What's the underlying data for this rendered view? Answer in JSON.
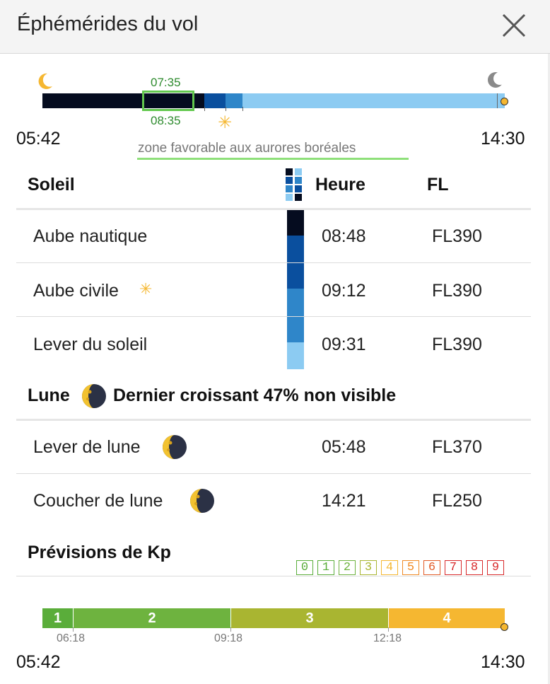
{
  "header": {
    "title": "Éphémérides du vol",
    "close_icon": "close-icon"
  },
  "timeline": {
    "start_time": "05:42",
    "end_time": "14:30",
    "aurora_start": "07:35",
    "aurora_end": "08:35",
    "aurora_label": "zone favorable aux aurores boréales",
    "colors": {
      "night": "#050c1f",
      "nautical": "#0a4f9e",
      "civil": "#2f86c9",
      "day": "#8ccbf2",
      "aurora": "#62c84e",
      "sun": "#f5b731"
    }
  },
  "sun": {
    "title": "Soleil",
    "col_time": "Heure",
    "col_fl": "FL",
    "rows": [
      {
        "label": "Aube nautique",
        "time": "08:48",
        "fl": "FL390"
      },
      {
        "label": "Aube civile",
        "time": "09:12",
        "fl": "FL390"
      },
      {
        "label": "Lever du soleil",
        "time": "09:31",
        "fl": "FL390"
      }
    ]
  },
  "moon": {
    "title": "Lune",
    "phase": "Dernier croissant 47% non visible",
    "rows": [
      {
        "label": "Lever de lune",
        "time": "05:48",
        "fl": "FL370"
      },
      {
        "label": "Coucher de lune",
        "time": "14:21",
        "fl": "FL250"
      }
    ]
  },
  "kp": {
    "title": "Prévisions de Kp",
    "scale": [
      "0",
      "1",
      "2",
      "3",
      "4",
      "5",
      "6",
      "7",
      "8",
      "9"
    ],
    "bar": [
      {
        "value": "1",
        "color": "#5aad3a"
      },
      {
        "value": "2",
        "color": "#6eb33f"
      },
      {
        "value": "3",
        "color": "#a9b531"
      },
      {
        "value": "4",
        "color": "#f5b731"
      }
    ],
    "ticks": [
      "06:18",
      "09:18",
      "12:18"
    ],
    "start_time": "05:42",
    "end_time": "14:30"
  }
}
